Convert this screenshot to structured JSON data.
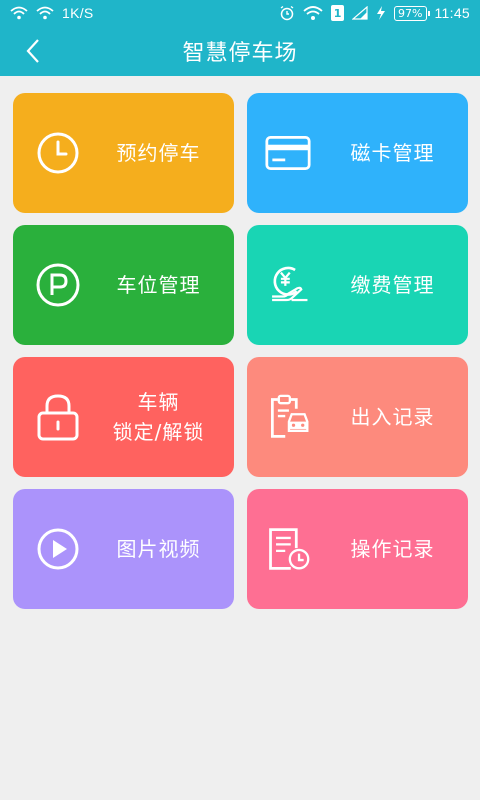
{
  "status_bar": {
    "net_speed": "1K/S",
    "sim_label": "1",
    "battery": "97%",
    "time": "11:45"
  },
  "app_bar": {
    "title": "智慧停车场",
    "back_icon": "chevron-left-icon"
  },
  "tiles": [
    {
      "label": "预约停车",
      "icon": "clock-icon",
      "color": "#f5ae1d"
    },
    {
      "label": "磁卡管理",
      "icon": "card-icon",
      "color": "#2fb2fb"
    },
    {
      "label": "车位管理",
      "icon": "parking-icon",
      "color": "#2ab03c"
    },
    {
      "label": "缴费管理",
      "icon": "payment-hand-icon",
      "color": "#19d5b4"
    },
    {
      "label_line1": "车辆",
      "label_line2": "锁定/解锁",
      "icon": "lock-icon",
      "color": "#ff625f"
    },
    {
      "label": "出入记录",
      "icon": "entry-exit-record-icon",
      "color": "#fd8a7d"
    },
    {
      "label": "图片视频",
      "icon": "play-icon",
      "color": "#ab93fb"
    },
    {
      "label": "操作记录",
      "icon": "operation-record-icon",
      "color": "#fe6f93"
    }
  ]
}
